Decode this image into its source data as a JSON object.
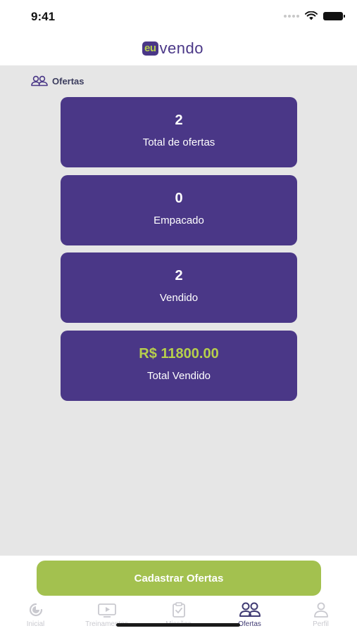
{
  "status_bar": {
    "time": "9:41"
  },
  "header": {
    "logo_badge": "eu",
    "logo_text": "vendo",
    "colors": {
      "brand_purple": "#4a3787",
      "brand_green": "#b6cf4c"
    }
  },
  "section": {
    "title": "Ofertas",
    "icon": "users-icon"
  },
  "cards": [
    {
      "value": "2",
      "label": "Total de ofertas"
    },
    {
      "value": "0",
      "label": "Empacado"
    },
    {
      "value": "2",
      "label": "Vendido"
    },
    {
      "value": "R$ 11800.00",
      "label": "Total Vendido"
    }
  ],
  "primary_button": {
    "label": "Cadastrar Ofertas",
    "color": "#a3c14f"
  },
  "tabs": [
    {
      "label": "Inicial",
      "icon": "home-icon",
      "active": false
    },
    {
      "label": "Treinamentos",
      "icon": "video-icon",
      "active": false
    },
    {
      "label": "Missões",
      "icon": "clipboard-icon",
      "active": false
    },
    {
      "label": "Ofertas",
      "icon": "users-icon",
      "active": true
    },
    {
      "label": "Perfil",
      "icon": "user-icon",
      "active": false
    }
  ]
}
